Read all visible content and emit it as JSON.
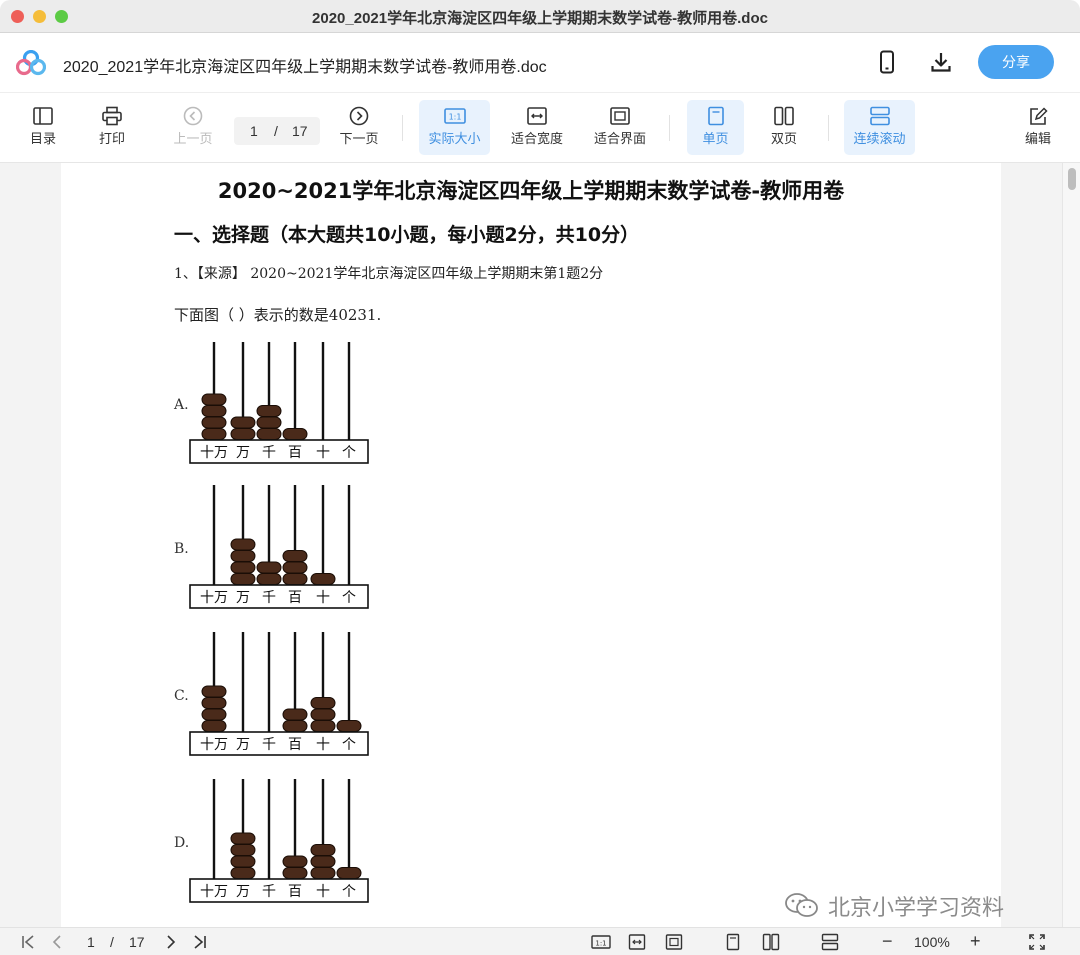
{
  "window": {
    "title": "2020_2021学年北京海淀区四年级上学期期末数学试卷-教师用卷.doc"
  },
  "header": {
    "doc_title": "2020_2021学年北京海淀区四年级上学期期末数学试卷-教师用卷.doc",
    "share_label": "分享",
    "icons": [
      "app-logo",
      "phone-icon",
      "download-icon"
    ]
  },
  "toolbar": {
    "toc": "目录",
    "print": "打印",
    "prev": "上一页",
    "page_current": "1",
    "page_sep": "/",
    "page_total": "17",
    "next": "下一页",
    "actual_size": "实际大小",
    "fit_width": "适合宽度",
    "fit_page": "适合界面",
    "single_page": "单页",
    "double_page": "双页",
    "continuous": "连续滚动",
    "edit": "编辑",
    "active": [
      "actual_size",
      "single_page",
      "continuous"
    ]
  },
  "document": {
    "title": "2020~2021学年北京海淀区四年级上学期期末数学试卷-教师用卷",
    "section": "一、选择题（本大题共10小题，每小题2分，共10分）",
    "question1": {
      "source": "1、【来源】 2020~2021学年北京海淀区四年级上学期期末第1题2分",
      "stem": "下面图（   ）表示的数是40231.",
      "place_labels": [
        "十万",
        "万",
        "千",
        "百",
        "十",
        "个"
      ],
      "options": [
        {
          "label": "A.",
          "beads": [
            4,
            2,
            3,
            1,
            0,
            0
          ]
        },
        {
          "label": "B.",
          "beads": [
            0,
            4,
            2,
            3,
            1,
            0
          ]
        },
        {
          "label": "C.",
          "beads": [
            4,
            0,
            0,
            2,
            3,
            1
          ]
        },
        {
          "label": "D.",
          "beads": [
            0,
            4,
            0,
            2,
            3,
            1
          ]
        }
      ]
    }
  },
  "statusbar": {
    "page_current": "1",
    "page_sep": "/",
    "page_total": "17",
    "zoom": "100%",
    "zoom_out": "−",
    "zoom_in": "+"
  },
  "watermark": "北京小学学习资料",
  "colors": {
    "accent": "#4aa3f0",
    "bead": "#4a2a1a",
    "active_bg": "#e8f2fd"
  }
}
